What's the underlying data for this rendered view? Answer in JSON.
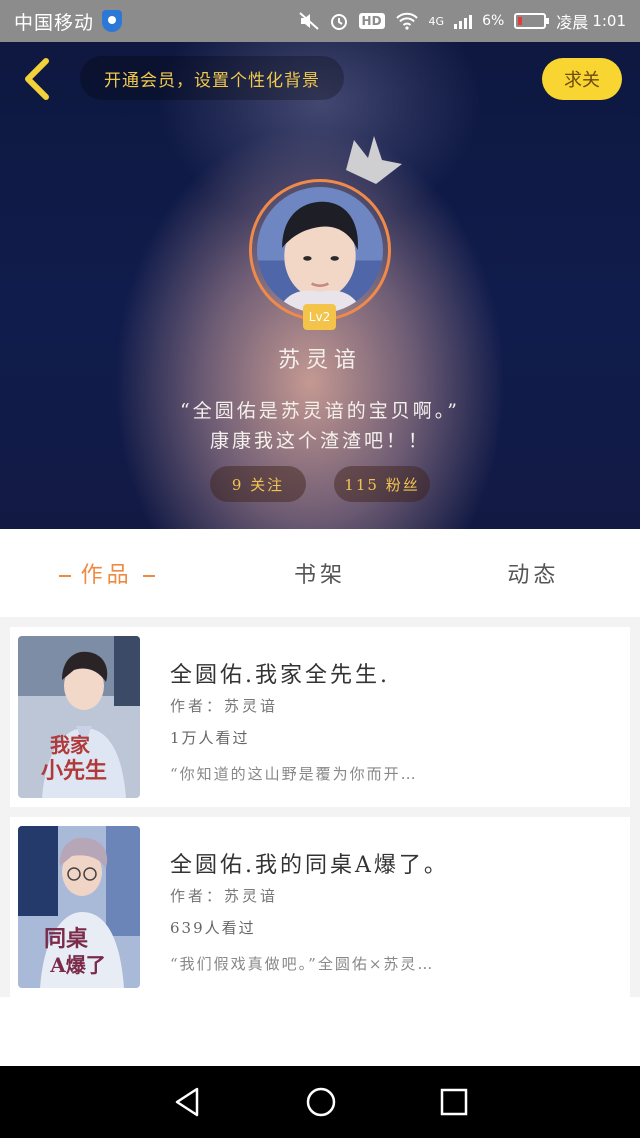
{
  "status_bar": {
    "carrier": "中国移动",
    "network": "4G",
    "battery": "6%",
    "time": "1:01",
    "time_prefix": "凌晨"
  },
  "header": {
    "banner_text": "开通会员，设置个性化背景",
    "action_label": "求关",
    "level": "Lv2",
    "username": "苏灵谙",
    "bio_line1": "“全圆佑是苏灵谙的宝贝啊。”",
    "bio_line2": "康康我这个渣渣吧！！",
    "following_label": "9 关注",
    "followers_label": "115 粉丝"
  },
  "tabs": [
    {
      "label": "作品",
      "active": true
    },
    {
      "label": "书架",
      "active": false
    },
    {
      "label": "动态",
      "active": false
    }
  ],
  "works": [
    {
      "title": "全圆佑.我家全先生.",
      "author": "作者：苏灵谙",
      "views": "1万人看过",
      "desc": "“你知道的这山野是覆为你而开…",
      "cover_text": "我家小先生"
    },
    {
      "title": "全圆佑.我的同桌A爆了。",
      "author": "作者：苏灵谙",
      "views": "639人看过",
      "desc": "“我们假戏真做吧。”全圆佑×苏灵…",
      "cover_text": "同桌A爆了"
    }
  ],
  "colors": {
    "accent": "#ee8a44",
    "gold": "#f2c451",
    "action_bg": "#f9d531"
  }
}
